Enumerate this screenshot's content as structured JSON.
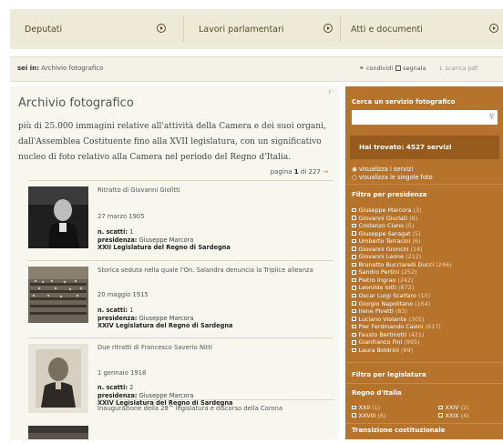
{
  "nav": {
    "items": [
      {
        "label": "Deputati"
      },
      {
        "label": "Lavori parlamentari"
      },
      {
        "label": "Atti e documenti"
      }
    ]
  },
  "breadcrumb": {
    "prefix": "sei in:",
    "current": "Archivio fotografico"
  },
  "tools": {
    "share": "condividi",
    "report": "segnala",
    "download": "scarica pdf"
  },
  "main": {
    "title": "Archivio fotografico",
    "intro": "più di 25.000 immagini relative all'attività della Camera e dei suoi organi, dall'Assemblea Costituente fino alla XVII legislatura, con un significativo nucleo di foto relativo alla Camera nel periodo del Regno d'Italia.",
    "page_label": "pagina",
    "page_current": "1",
    "page_of": "di 227",
    "page_arrow": "→",
    "items": [
      {
        "desc": "Ritratto di Giovanni Giolitti",
        "date": "27 marzo 1905",
        "shots_label": "n. scatti:",
        "shots": "1",
        "pres_label": "presidenza:",
        "pres": "Giuseppe Marcora",
        "legislature": "XXII Legislatura del Regno di Sardegna"
      },
      {
        "desc": "Storica seduta nella quale l'On. Salandra denuncia la Triplice alleanza",
        "date": "20 maggio 1915",
        "shots_label": "n. scatti:",
        "shots": "1",
        "pres_label": "presidenza:",
        "pres": "Giuseppe Marcora",
        "legislature": "XXIV Legislatura del Regno di Sardegna"
      },
      {
        "desc": "Due ritratti di Francesco Saverio Nitti",
        "date": "1 gennaio 1918",
        "shots_label": "n. scatti:",
        "shots": "2",
        "pres_label": "presidenza:",
        "pres": "Giuseppe Marcora",
        "legislature": "XXIV Legislatura del Regno di Sardegna"
      },
      {
        "desc": "Inaugurazione della 28^ legislatura e discorso della Corona"
      }
    ]
  },
  "sidebar": {
    "search_heading": "Cerca un servizio fotografico",
    "found": "Hai trovato: 4527 servizi",
    "view_services": "visualizza i servizi",
    "view_photos": "visualizza le singole foto",
    "presidency_heading": "Filtra per presidenza",
    "presidencies": [
      {
        "name": "Giuseppe Marcora",
        "count": "(3)"
      },
      {
        "name": "Giovanni Giuriati",
        "count": "(6)"
      },
      {
        "name": "Costanzo Ciano",
        "count": "(5)"
      },
      {
        "name": "Giuseppe Saragat",
        "count": "(5)"
      },
      {
        "name": "Umberto Terracini",
        "count": "(6)"
      },
      {
        "name": "Giovanni Gronchi",
        "count": "(14)"
      },
      {
        "name": "Giovanni Leone",
        "count": "(212)"
      },
      {
        "name": "Brunetto Bucciarelli Ducci",
        "count": "(246)"
      },
      {
        "name": "Sandro Pertini",
        "count": "(252)"
      },
      {
        "name": "Pietro Ingrao",
        "count": "(242)"
      },
      {
        "name": "Leonilde Iotti",
        "count": "(872)"
      },
      {
        "name": "Oscar Luigi Scalfaro",
        "count": "(10)"
      },
      {
        "name": "Giorgio Napolitano",
        "count": "(164)"
      },
      {
        "name": "Irene Pivetti",
        "count": "(83)"
      },
      {
        "name": "Luciano Violante",
        "count": "(305)"
      },
      {
        "name": "Pier Ferdinando Casini",
        "count": "(617)"
      },
      {
        "name": "Fausto Bertinotti",
        "count": "(421)"
      },
      {
        "name": "Gianfranco Fini",
        "count": "(995)"
      },
      {
        "name": "Laura Boldrini",
        "count": "(69)"
      }
    ],
    "legislature_heading": "Filtra per legislatura",
    "kingdom_heading": "Regno d'Italia",
    "kingdom_items": [
      {
        "name": "XXII",
        "count": "(1)"
      },
      {
        "name": "XXIV",
        "count": "(2)"
      },
      {
        "name": "XXVIII",
        "count": "(6)"
      },
      {
        "name": "XXIX",
        "count": "(4)"
      }
    ],
    "transition_heading": "Transizione costituzionale"
  },
  "colors": {
    "sidebar": "#b5732b",
    "found_box": "#965b1d",
    "nav_band": "#eeead8"
  }
}
